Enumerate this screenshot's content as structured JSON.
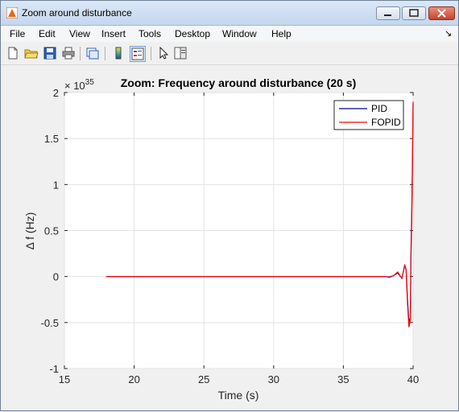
{
  "window": {
    "title": "Zoom around disturbance"
  },
  "menu": [
    "File",
    "Edit",
    "View",
    "Insert",
    "Tools",
    "Desktop",
    "Window",
    "Help"
  ],
  "toolbar": [
    "new-figure-icon",
    "open-file-icon",
    "save-icon",
    "print-icon",
    "link-plot-icon",
    "colorbar-icon",
    "legend-icon",
    "pointer-icon",
    "property-editor-icon"
  ],
  "chart_data": {
    "type": "line",
    "title": "Zoom: Frequency around disturbance (20 s)",
    "xlabel": "Time (s)",
    "ylabel": "Δ f (Hz)",
    "y_exponent_label": "× 10",
    "y_exponent": "35",
    "xlim": [
      15,
      40
    ],
    "ylim": [
      -1,
      2
    ],
    "xticks": [
      "15",
      "20",
      "25",
      "30",
      "35",
      "40"
    ],
    "yticks": [
      "-1",
      "-0.5",
      "0",
      "0.5",
      "1",
      "1.5",
      "2"
    ],
    "grid": true,
    "legend_position": "top-right",
    "series": [
      {
        "name": "PID",
        "color": "#00008b",
        "x": [
          18,
          38.0,
          38.3,
          38.6,
          38.9,
          39.2,
          39.4,
          39.5,
          39.6,
          39.7,
          39.8,
          39.85,
          39.9,
          39.95,
          40.0
        ],
        "y": [
          0,
          0,
          -0.005,
          0.01,
          0.04,
          -0.02,
          0.12,
          0.08,
          -0.25,
          -0.5,
          -0.45,
          0.3,
          0.7,
          1.2,
          1.88
        ]
      },
      {
        "name": "FOPID",
        "color": "#ff0000",
        "x": [
          18,
          38.0,
          38.3,
          38.6,
          38.9,
          39.2,
          39.4,
          39.5,
          39.6,
          39.7,
          39.8,
          39.85,
          39.9,
          39.95,
          40.0
        ],
        "y": [
          0,
          0,
          -0.01,
          0.01,
          0.05,
          -0.02,
          0.13,
          0.07,
          -0.3,
          -0.55,
          -0.48,
          0.2,
          0.6,
          1.1,
          1.9
        ]
      }
    ]
  }
}
